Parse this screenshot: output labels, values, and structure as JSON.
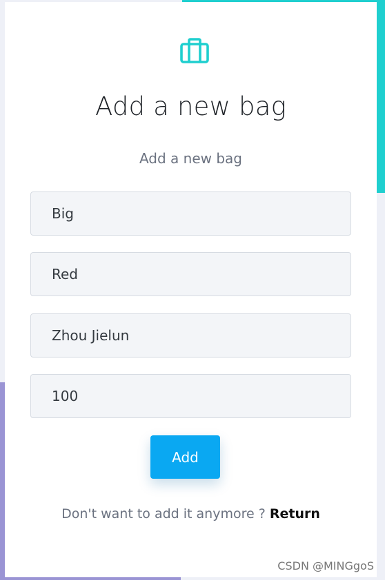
{
  "page": {
    "title": "Add a new bag",
    "subtitle": "Add a new bag"
  },
  "logo": {
    "icon": "briefcase-icon",
    "color": "#1fcfcf"
  },
  "form": {
    "fields": [
      {
        "value": "Big"
      },
      {
        "value": "Red"
      },
      {
        "value": "Zhou Jielun"
      },
      {
        "value": "100"
      }
    ],
    "submit_label": "Add"
  },
  "footer": {
    "prompt": "Don't want to add it anymore ?",
    "link_label": "Return"
  },
  "watermark": "CSDN @MINGgoS",
  "colors": {
    "accent_teal": "#1fcfcf",
    "accent_purple": "#9a94d4",
    "button": "#0aa8f2"
  }
}
